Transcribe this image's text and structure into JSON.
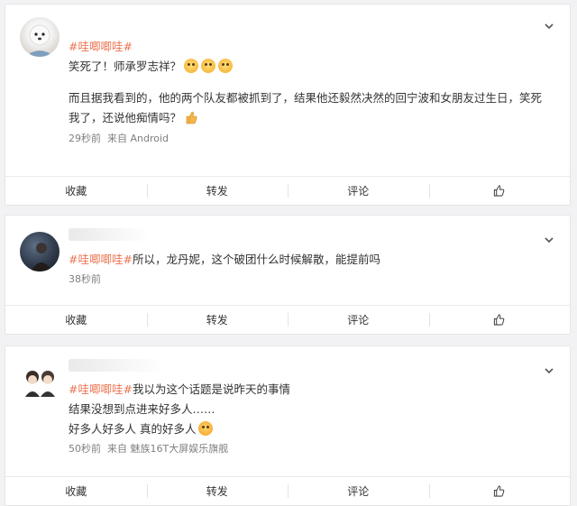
{
  "actions": {
    "collect": "收藏",
    "repost": "转发",
    "comment": "评论"
  },
  "posts": [
    {
      "topic": "#哇唧唧哇#",
      "line1": "笑死了！师承罗志祥？",
      "line2": "而且据我看到的，他的两个队友都被抓到了，结果他还毅然决然的回宁波和女朋友过生日，笑死",
      "line3": "我了，还说他痴情吗？",
      "time": "29秒前",
      "source": "来自 Android"
    },
    {
      "topic": "#哇唧唧哇#",
      "text": "所以，龙丹妮，这个破团什么时候解散，能提前吗",
      "time": "38秒前"
    },
    {
      "topic": "#哇唧唧哇#",
      "text": "我以为这个话题是说昨天的事情",
      "line2": "结果没想到点进来好多人……",
      "line3": "好多人好多人 真的好多人",
      "time": "50秒前",
      "source": "来自 魅族16T大屏娱乐旗舰"
    }
  ],
  "colors": {
    "topic": "#eb7350",
    "meta": "#808080",
    "bg": "#f2f2f5"
  },
  "icons": [
    "chevron-down-icon",
    "thumbs-up-icon",
    "emoji-icon"
  ]
}
